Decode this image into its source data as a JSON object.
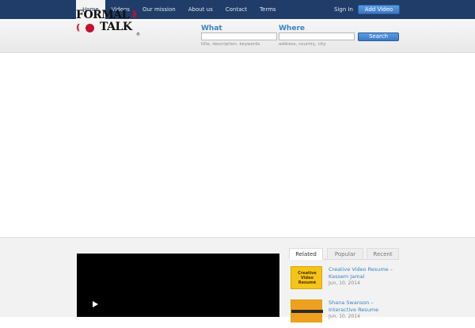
{
  "nav": {
    "items": [
      {
        "label": "Home",
        "active": true
      },
      {
        "label": "Videos",
        "active": false
      },
      {
        "label": "Our mission",
        "active": false
      },
      {
        "label": "About us",
        "active": false
      },
      {
        "label": "Contact",
        "active": false
      },
      {
        "label": "Terms",
        "active": false
      }
    ],
    "signin_label": "Sign In",
    "add_video_label": "Add Video"
  },
  "logo": {
    "line1": "FORMAL",
    "line2": "TALK",
    "registered": "®"
  },
  "search": {
    "what_label": "What",
    "what_hint": "title, description, keywords",
    "where_label": "Where",
    "where_hint": "address, country, city",
    "button_label": "Search"
  },
  "sidebar": {
    "tabs": [
      {
        "label": "Related",
        "active": true
      },
      {
        "label": "Popular",
        "active": false
      },
      {
        "label": "Recent",
        "active": false
      }
    ],
    "videos": [
      {
        "title": "Creative Video Resume – Kassem Jamal",
        "date": "Jun, 10, 2014",
        "thumb_text": "Creative Video Resumé"
      },
      {
        "title": "Shana Swanson – Interactive Resume",
        "date": "Jun, 10, 2014",
        "thumb_text": ""
      }
    ]
  },
  "colors": {
    "nav_bg": "#1f3d68",
    "accent": "#3a83c2",
    "brand_red": "#c8102e",
    "player_bg": "#000000"
  }
}
